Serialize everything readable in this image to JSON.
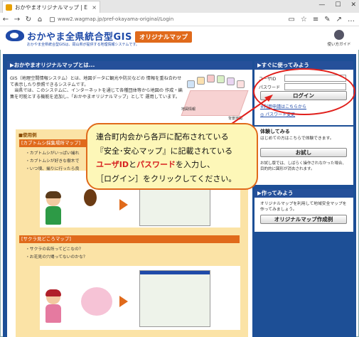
{
  "browser": {
    "tab_title": "おかやまオリジナルマップ | E",
    "tab_close": "×",
    "url": "www2.wagmap.jp/pref-okayama-original/Login",
    "win_minimize": "—",
    "win_maximize": "☐",
    "win_close": "✕",
    "nav_back": "←",
    "nav_forward": "→",
    "nav_reload": "↻",
    "nav_home": "⌂",
    "nav_reading": "▭",
    "nav_star": "☆",
    "nav_hub": "≡",
    "nav_note": "✎",
    "nav_share": "↗",
    "nav_more": "…"
  },
  "header": {
    "site_title": "おかやま全県統合型GIS",
    "site_subtitle": "おかやま全県統合型GISは、岡山県が提供する地理情報システムです。",
    "badge": "オリジナルマップ",
    "guide_label": "使い方ガイド"
  },
  "main": {
    "section_title": "▶おかやまオリジナルマップとは...",
    "intro_p1": "GIS（地理空間情報システム）とは、地図データに観光や防災などの 情報を重ね合わせて表示したり参照できるシステムです。",
    "intro_p2": "当県では、このシステムに、インターネットを通じて各種団体等から地図の 作成・編集を可能とする機能を追加し、「おかやまオリジナルマップ」として 運用しています。",
    "map_label1": "地図情報",
    "map_label2": "背景地図",
    "examples_head": "■使用例",
    "example1": {
      "title": "[カブトムシ採集場所マップ]",
      "items": [
        "・カブトムシがいっぱい捕れ",
        "・カブトムシが好きな樹木で",
        "・いつ頃、捕りに行ったら良"
      ]
    },
    "example2": {
      "title": "[サクラ見どころマップ]",
      "items": [
        "・サクラの名所ってどこなの？",
        "・お花見の穴場ってないのかな？"
      ]
    }
  },
  "sidebar": {
    "login_title": "▶すぐに使ってみよう",
    "userid_label": "ユーザID",
    "password_label": "パスワード",
    "login_button": "ログイン",
    "apply_link": "※利用申請はこちらから",
    "password_change": "◎ パスワード変更",
    "trial_title": "体験してみる",
    "trial_desc": "はじめての方はこちらで体験できます。",
    "trial_button": "お試し",
    "trial_note": "お試し版では、しばらく操作されなかった場合、目的的に図形が消去されます。",
    "make_title": "▶作ってみよう",
    "make_desc": "オリジナルマップを利用して地域安全マップを作ってみましょう。",
    "make_button": "オリジナルマップ作成例"
  },
  "callout": {
    "line1": "連合町内会から各戸に配布されている",
    "line2": "『安全･安心マップ』に記載されている",
    "line3_userid": "ユーザID",
    "line3_and": "と",
    "line3_password": "パスワード",
    "line3_rest": "を入力し、",
    "line4": "［ログイン］をクリックしてください。"
  },
  "colors": {
    "brand_blue": "#1d4f96",
    "accent_orange": "#e06a1b",
    "callout_bg": "#fdf7b8",
    "highlight_red": "#e0201c"
  }
}
